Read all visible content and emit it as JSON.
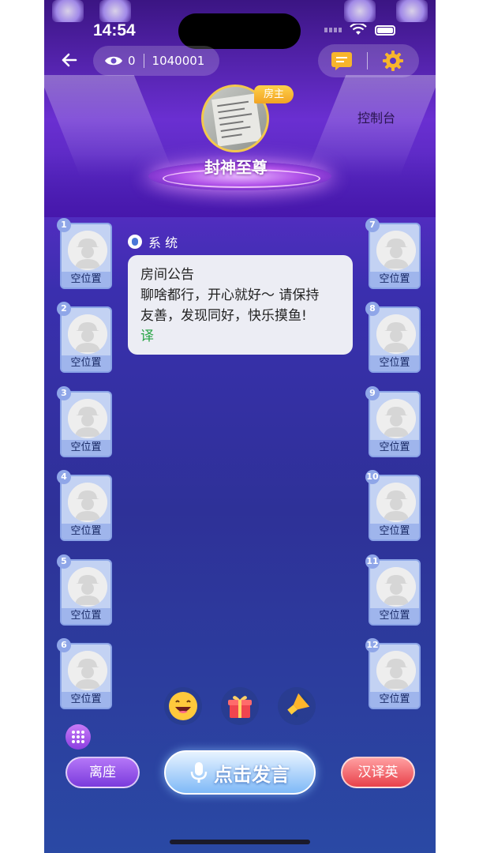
{
  "status_bar": {
    "time": "14:54"
  },
  "header": {
    "viewers": "0",
    "room_id": "1040001",
    "console_label": "控制台"
  },
  "host": {
    "badge": "房主",
    "name": "封神至尊"
  },
  "seats": {
    "left": [
      {
        "number": "1",
        "label": "空位置"
      },
      {
        "number": "2",
        "label": "空位置"
      },
      {
        "number": "3",
        "label": "空位置"
      },
      {
        "number": "4",
        "label": "空位置"
      },
      {
        "number": "5",
        "label": "空位置"
      },
      {
        "number": "6",
        "label": "空位置"
      }
    ],
    "right": [
      {
        "number": "7",
        "label": "空位置"
      },
      {
        "number": "8",
        "label": "空位置"
      },
      {
        "number": "9",
        "label": "空位置"
      },
      {
        "number": "10",
        "label": "空位置"
      },
      {
        "number": "11",
        "label": "空位置"
      },
      {
        "number": "12",
        "label": "空位置"
      }
    ]
  },
  "chat": {
    "sender": "系 统",
    "lines": [
      "房间公告",
      "聊啥都行，开心就好～ 请保持",
      "友善，发现同好，快乐摸鱼!"
    ],
    "translate": "译"
  },
  "bottom": {
    "leave_label": "离座",
    "speak_label": "点击发言",
    "translate_label": "汉译英"
  },
  "colors": {
    "accent_purple": "#7a3bdc",
    "accent_red": "#e8414a",
    "host_gold": "#f3c84d",
    "seat_blue": "#c3d2f3"
  },
  "icons": [
    "back-arrow-icon",
    "eye-icon",
    "message-icon",
    "gear-icon",
    "emoji-icon",
    "gift-icon",
    "megaphone-icon",
    "grid-icon",
    "mic-icon"
  ]
}
